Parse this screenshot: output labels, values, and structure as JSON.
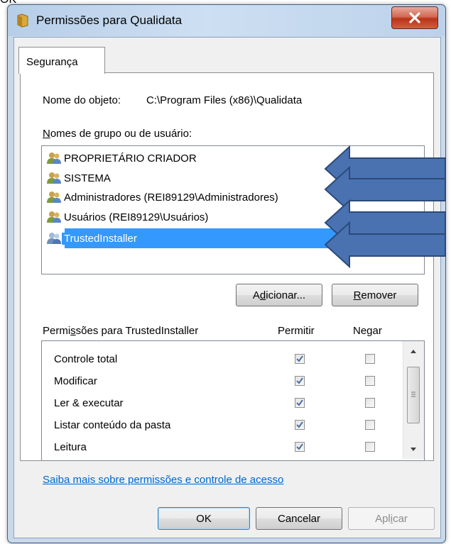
{
  "background_caption": "OK",
  "window": {
    "title": "Permissões para Qualidata",
    "close_glyph": "X"
  },
  "tab": {
    "label": "Segurança"
  },
  "object": {
    "label": "Nome do objeto:",
    "path": "C:\\Program Files (x86)\\Qualidata"
  },
  "groups": {
    "label_access_key": "N",
    "label_rest": "omes de grupo ou de usuário:",
    "items": [
      {
        "label": "PROPRIETÁRIO CRIADOR",
        "icon": "users-icon"
      },
      {
        "label": "SISTEMA",
        "icon": "users-icon"
      },
      {
        "label": "Administradores (REI89129\\Administradores)",
        "icon": "users-icon"
      },
      {
        "label": "Usuários (REI89129\\Usuários)",
        "icon": "users-icon"
      },
      {
        "label": "TrustedInstaller",
        "icon": "users-icon",
        "selected": true
      }
    ]
  },
  "buttons": {
    "add": {
      "pre": "A",
      "key": "d",
      "post": "icionar..."
    },
    "remove": {
      "pre": "",
      "key": "R",
      "post": "emover"
    },
    "ok": "OK",
    "cancel": "Cancelar",
    "apply": {
      "pre": "Apl",
      "key": "i",
      "post": "car"
    }
  },
  "permissions": {
    "header_pre": "Permi",
    "header_key": "s",
    "header_post": "sões para TrustedInstaller",
    "allow_header": "Permitir",
    "deny_header": "Negar",
    "rows": [
      {
        "name": "Controle total",
        "allow": true,
        "deny": false
      },
      {
        "name": "Modificar",
        "allow": true,
        "deny": false
      },
      {
        "name": "Ler & executar",
        "allow": true,
        "deny": false
      },
      {
        "name": "Listar conteúdo da pasta",
        "allow": true,
        "deny": false
      },
      {
        "name": "Leitura",
        "allow": true,
        "deny": false
      }
    ]
  },
  "help_link": "Saiba mais sobre permissões e controle de acesso",
  "colors": {
    "selection": "#3399ff",
    "arrow_fill": "#4a72b0",
    "arrow_stroke": "#2b4a7a",
    "link": "#0066cc",
    "close_red": "#c7442b"
  }
}
